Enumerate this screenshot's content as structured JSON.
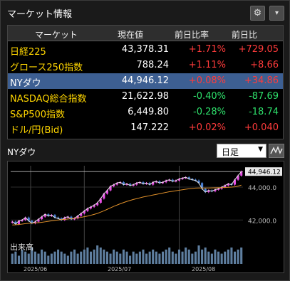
{
  "window": {
    "title": "マーケット情報"
  },
  "toolbar": {
    "gear_icon": "gear-icon",
    "menu_icon": "menu-down-icon"
  },
  "table": {
    "headers": [
      "マーケット",
      "現在値",
      "前日比率",
      "前日比"
    ],
    "rows": [
      {
        "name": "日経225",
        "price": "43,378.31",
        "pct": "+1.71%",
        "diff": "+729.05",
        "dir": "up"
      },
      {
        "name": "グロース250指数",
        "price": "788.24",
        "pct": "+1.11%",
        "diff": "+8.66",
        "dir": "up"
      },
      {
        "name": "NYダウ",
        "price": "44,946.12",
        "pct": "+0.08%",
        "diff": "+34.86",
        "dir": "up",
        "selected": true
      },
      {
        "name": "NASDAQ総合指数",
        "price": "21,622.98",
        "pct": "-0.40%",
        "diff": "-87.69",
        "dir": "down"
      },
      {
        "name": "S&P500指数",
        "price": "6,449.80",
        "pct": "-0.28%",
        "diff": "-18.74",
        "dir": "down"
      },
      {
        "name": "ドル/円(Bid)",
        "price": "147.222",
        "pct": "+0.02%",
        "diff": "+0.040",
        "dir": "up"
      }
    ]
  },
  "chart": {
    "name": "NYダウ",
    "period_select": "日足",
    "volume_label": "出来高",
    "last_price_tag": "44,946.12",
    "y_labels": [
      "44,000.0",
      "42,000.0"
    ],
    "x_labels": [
      "2025/06",
      "2025/07",
      "2025/08"
    ]
  },
  "chart_data": {
    "type": "line",
    "title": "",
    "xlabel": "",
    "ylabel": "",
    "ylim": [
      40800,
      45300
    ],
    "series": [
      {
        "values": [
          41900,
          41750,
          41950,
          42000,
          42150,
          41950,
          41800,
          41900,
          42050,
          42200,
          42350,
          42250,
          42300,
          42150,
          42100,
          42000,
          42150,
          42200,
          42050,
          42100,
          42250,
          42400,
          42550,
          42700,
          42800,
          42900,
          43050,
          43300,
          43600,
          43800,
          44050,
          44150,
          44250,
          44300,
          44150,
          44200,
          44100,
          44150,
          44250,
          44300,
          44200,
          44250,
          44150,
          44300,
          44350,
          44250,
          44300,
          44400,
          44450,
          44350,
          44400,
          44500,
          44550,
          44600,
          44500,
          44450,
          44400,
          44250,
          43900,
          43700,
          43800,
          43750,
          43850,
          43900,
          44000,
          44100,
          44200,
          44150,
          44450,
          44700,
          44946
        ]
      },
      {
        "values": [
          41700,
          41710,
          41730,
          41750,
          41780,
          41800,
          41810,
          41820,
          41840,
          41860,
          41890,
          41920,
          41950,
          41980,
          42000,
          42020,
          42040,
          42060,
          42080,
          42100,
          42130,
          42160,
          42200,
          42240,
          42290,
          42340,
          42400,
          42480,
          42560,
          42650,
          42740,
          42830,
          42910,
          42990,
          43060,
          43130,
          43190,
          43250,
          43300,
          43350,
          43400,
          43440,
          43480,
          43520,
          43560,
          43600,
          43640,
          43680,
          43720,
          43750,
          43780,
          43810,
          43840,
          43870,
          43900,
          43920,
          43940,
          43950,
          43950,
          43950,
          43950,
          43955,
          43960,
          43965,
          43970,
          43980,
          43990,
          44000,
          44020,
          44060,
          44120
        ]
      }
    ],
    "volume": [
      5,
      6,
      4,
      7,
      6,
      5,
      8,
      6,
      5,
      7,
      6,
      4,
      5,
      6,
      7,
      6,
      5,
      4,
      6,
      7,
      5,
      6,
      7,
      8,
      6,
      7,
      9,
      8,
      7,
      6,
      5,
      7,
      6,
      5,
      7,
      6,
      4,
      6,
      5,
      6,
      7,
      5,
      6,
      7,
      6,
      5,
      6,
      7,
      8,
      6,
      5,
      7,
      6,
      8,
      7,
      5,
      6,
      9,
      7,
      8,
      6,
      5,
      7,
      6,
      5,
      6,
      7,
      8,
      6,
      7,
      8
    ]
  },
  "colors": {
    "up": "#ff3b3b",
    "down": "#2ee06b",
    "name": "#ffd600",
    "selected_row": "#3d5f92",
    "candle_up": "#e94ee6",
    "candle_down": "#4b82d8",
    "vol": "#5f7fa0",
    "ma_short": "#e8e8e8",
    "ma_long": "#e0902a"
  }
}
